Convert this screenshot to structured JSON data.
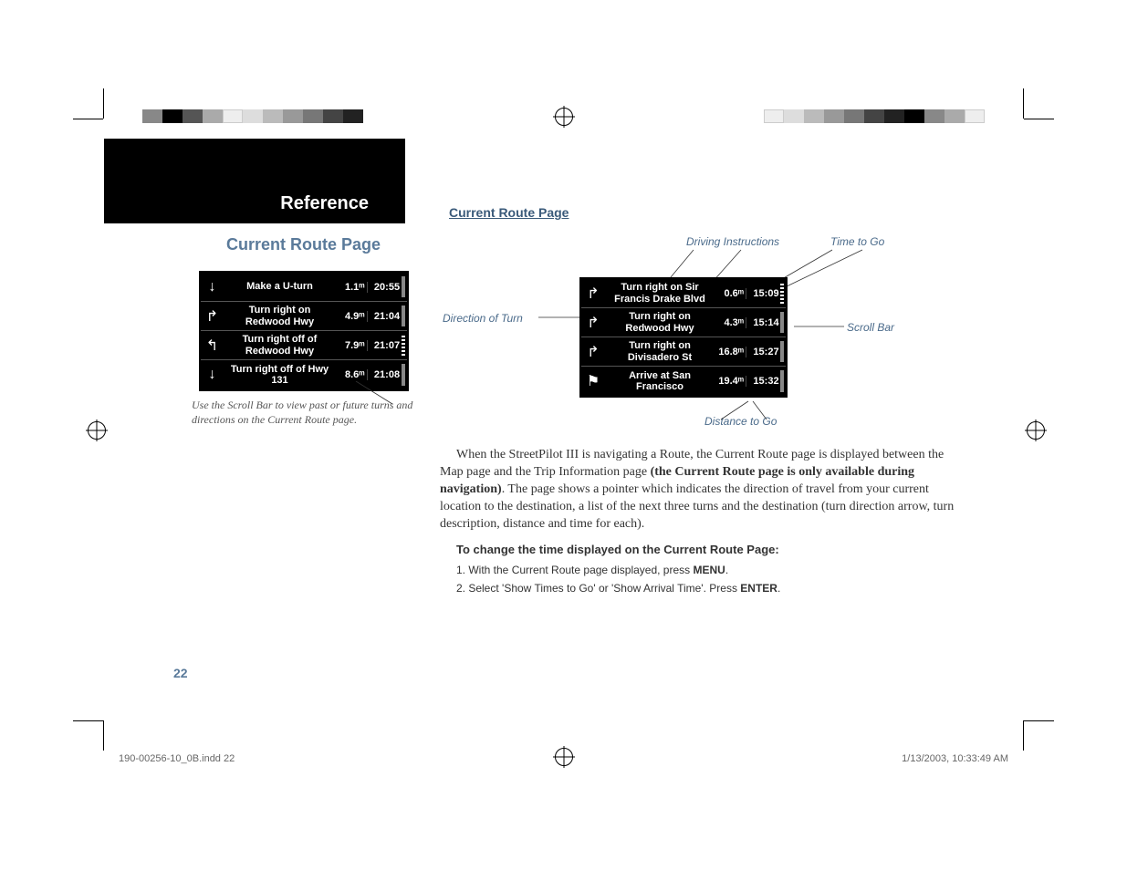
{
  "header": {
    "reference": "Reference",
    "section_title": "Current Route Page"
  },
  "left": {
    "title": "Current Route Page",
    "caption": "Use the Scroll Bar to view past or future turns and directions on the Current Route page.",
    "rows": [
      {
        "icon": "↓",
        "instr": "Make a U-turn",
        "dist": "1.1ᵐ",
        "time": "20:55"
      },
      {
        "icon": "↱",
        "instr": "Turn right on Redwood Hwy",
        "dist": "4.9ᵐ",
        "time": "21:04"
      },
      {
        "icon": "↰",
        "instr": "Turn right off of Redwood Hwy",
        "dist": "7.9ᵐ",
        "time": "21:07"
      },
      {
        "icon": "↓",
        "instr": "Turn right off of Hwy 131",
        "dist": "8.6ᵐ",
        "time": "21:08"
      }
    ]
  },
  "diagram": {
    "labels": {
      "driving": "Driving Instructions",
      "time": "Time to Go",
      "direction": "Direction of Turn",
      "scroll": "Scroll Bar",
      "distance": "Distance to Go"
    },
    "rows": [
      {
        "icon": "↱",
        "instr": "Turn right on Sir Francis Drake Blvd",
        "dist": "0.6ᵐ",
        "time": "15:09"
      },
      {
        "icon": "↱",
        "instr": "Turn right on Redwood Hwy",
        "dist": "4.3ᵐ",
        "time": "15:14"
      },
      {
        "icon": "↱",
        "instr": "Turn right on Divisadero St",
        "dist": "16.8ᵐ",
        "time": "15:27"
      },
      {
        "icon": "⚑",
        "instr": "Arrive at San Francisco",
        "dist": "19.4ᵐ",
        "time": "15:32"
      }
    ]
  },
  "body": {
    "para1a": "When the StreetPilot III is navigating a Route, the Current Route page is displayed between the Map page and the Trip Information page ",
    "para1b": "(the Current Route page is only available during navigation)",
    "para1c": ". The page shows a pointer which indicates the direction of travel from your current location to the destination, a list of the next three turns and the destination (turn direction arrow, turn description, distance and time for each).",
    "heading": "To change the time displayed on the Current Route Page:",
    "step1a": "1.  With the Current Route page displayed, press ",
    "step1b": "MENU",
    "step1c": ".",
    "step2a": "2.  Select 'Show Times to Go' or 'Show Arrival Time'.  Press ",
    "step2b": "ENTER",
    "step2c": "."
  },
  "page_number": "22",
  "footer": {
    "left": "190-00256-10_0B.indd   22",
    "right": "1/13/2003, 10:33:49 AM"
  }
}
